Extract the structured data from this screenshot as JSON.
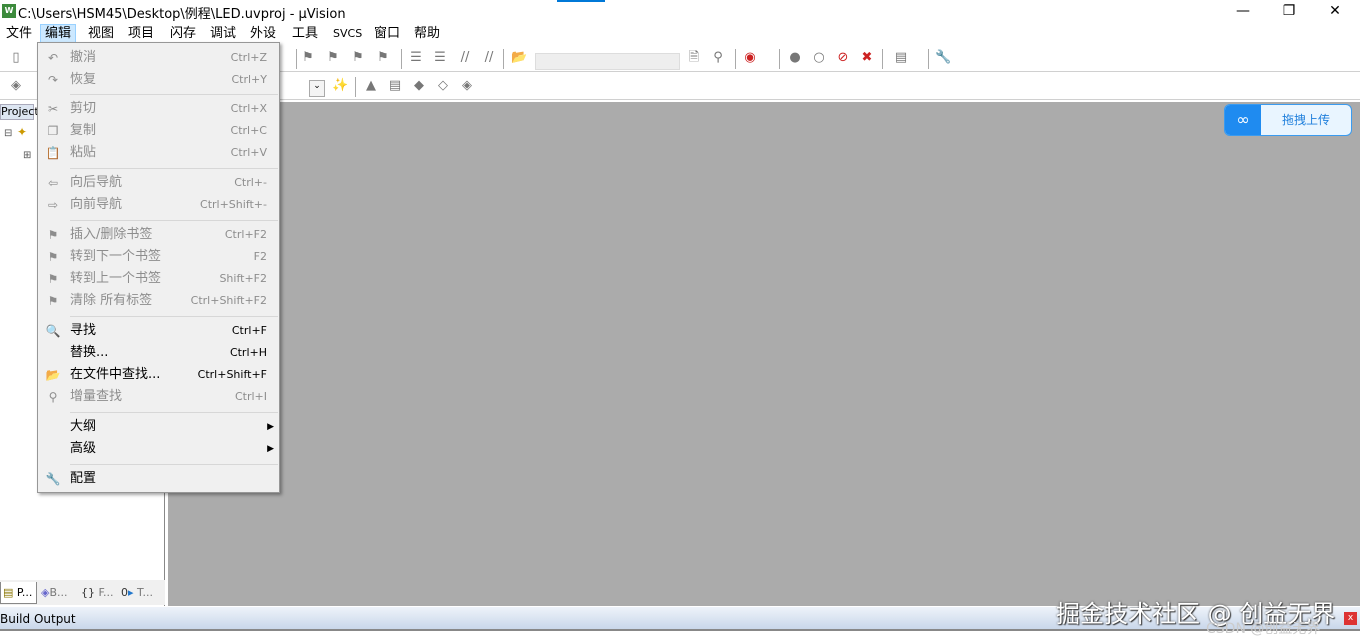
{
  "window": {
    "title": "C:\\Users\\HSM45\\Desktop\\例程\\LED.uvproj - µVision",
    "app_icon": "W",
    "minimize": "—",
    "restore": "❐",
    "close": "✕"
  },
  "menubar": [
    "文件",
    "编辑",
    "视图",
    "项目",
    "闪存",
    "调试",
    "外设",
    "工具",
    "SVCS",
    "窗口",
    "帮助"
  ],
  "edit_menu": [
    {
      "label": "撤消",
      "shortcut": "Ctrl+Z",
      "icon": "undo-icon",
      "glyph": "↶",
      "disabled": true
    },
    {
      "label": "恢复",
      "shortcut": "Ctrl+Y",
      "icon": "redo-icon",
      "glyph": "↷",
      "disabled": true
    },
    {
      "label": "剪切",
      "shortcut": "Ctrl+X",
      "icon": "cut-icon",
      "glyph": "✂",
      "disabled": true
    },
    {
      "label": "复制",
      "shortcut": "Ctrl+C",
      "icon": "copy-icon",
      "glyph": "❐",
      "disabled": true
    },
    {
      "label": "粘贴",
      "shortcut": "Ctrl+V",
      "icon": "paste-icon",
      "glyph": "📋",
      "disabled": true
    },
    {
      "label": "向后导航",
      "shortcut": "Ctrl+-",
      "icon": "back-arrow-icon",
      "glyph": "⇦",
      "disabled": true
    },
    {
      "label": "向前导航",
      "shortcut": "Ctrl+Shift+-",
      "icon": "forward-arrow-icon",
      "glyph": "⇨",
      "disabled": true
    },
    {
      "label": "插入/删除书签",
      "shortcut": "Ctrl+F2",
      "icon": "bookmark-icon",
      "glyph": "⚑",
      "disabled": true
    },
    {
      "label": "转到下一个书签",
      "shortcut": "F2",
      "icon": "next-bookmark-icon",
      "glyph": "⚑",
      "disabled": true
    },
    {
      "label": "转到上一个书签",
      "shortcut": "Shift+F2",
      "icon": "prev-bookmark-icon",
      "glyph": "⚑",
      "disabled": true
    },
    {
      "label": "清除 所有标签",
      "shortcut": "Ctrl+Shift+F2",
      "icon": "clear-bookmarks-icon",
      "glyph": "⚑",
      "disabled": true
    },
    {
      "label": "寻找",
      "shortcut": "Ctrl+F",
      "icon": "find-icon",
      "glyph": "🔍",
      "disabled": false
    },
    {
      "label": "替换...",
      "shortcut": "Ctrl+H",
      "icon": "",
      "glyph": "",
      "disabled": false
    },
    {
      "label": "在文件中查找...",
      "shortcut": "Ctrl+Shift+F",
      "icon": "find-in-files-icon",
      "glyph": "📂",
      "disabled": false
    },
    {
      "label": "增量查找",
      "shortcut": "Ctrl+I",
      "icon": "incremental-find-icon",
      "glyph": "⚲",
      "disabled": true
    },
    {
      "label": "大纲",
      "shortcut": "",
      "icon": "",
      "glyph": "",
      "disabled": false,
      "submenu": "▶"
    },
    {
      "label": "高级",
      "shortcut": "",
      "icon": "",
      "glyph": "",
      "disabled": false,
      "submenu": "▶"
    },
    {
      "label": "配置",
      "shortcut": "",
      "icon": "wrench-icon",
      "glyph": "🔧",
      "disabled": false
    }
  ],
  "project_panel": {
    "header": "Project",
    "tabs": [
      "P...",
      "B...",
      "F...",
      "T..."
    ]
  },
  "build_output": {
    "title": "Build Output",
    "close": "x"
  },
  "upload_widget": {
    "label": "拖拽上传",
    "icon": "∞"
  },
  "watermark": {
    "main": "掘金技术社区 @ 创益无界",
    "sub": "CSDN @创益无界"
  },
  "colors": {
    "accent": "#0078d7",
    "editor_bg": "#ababab",
    "menu_bg": "#f0f0f0",
    "upload_blue": "#1f8bf0"
  }
}
